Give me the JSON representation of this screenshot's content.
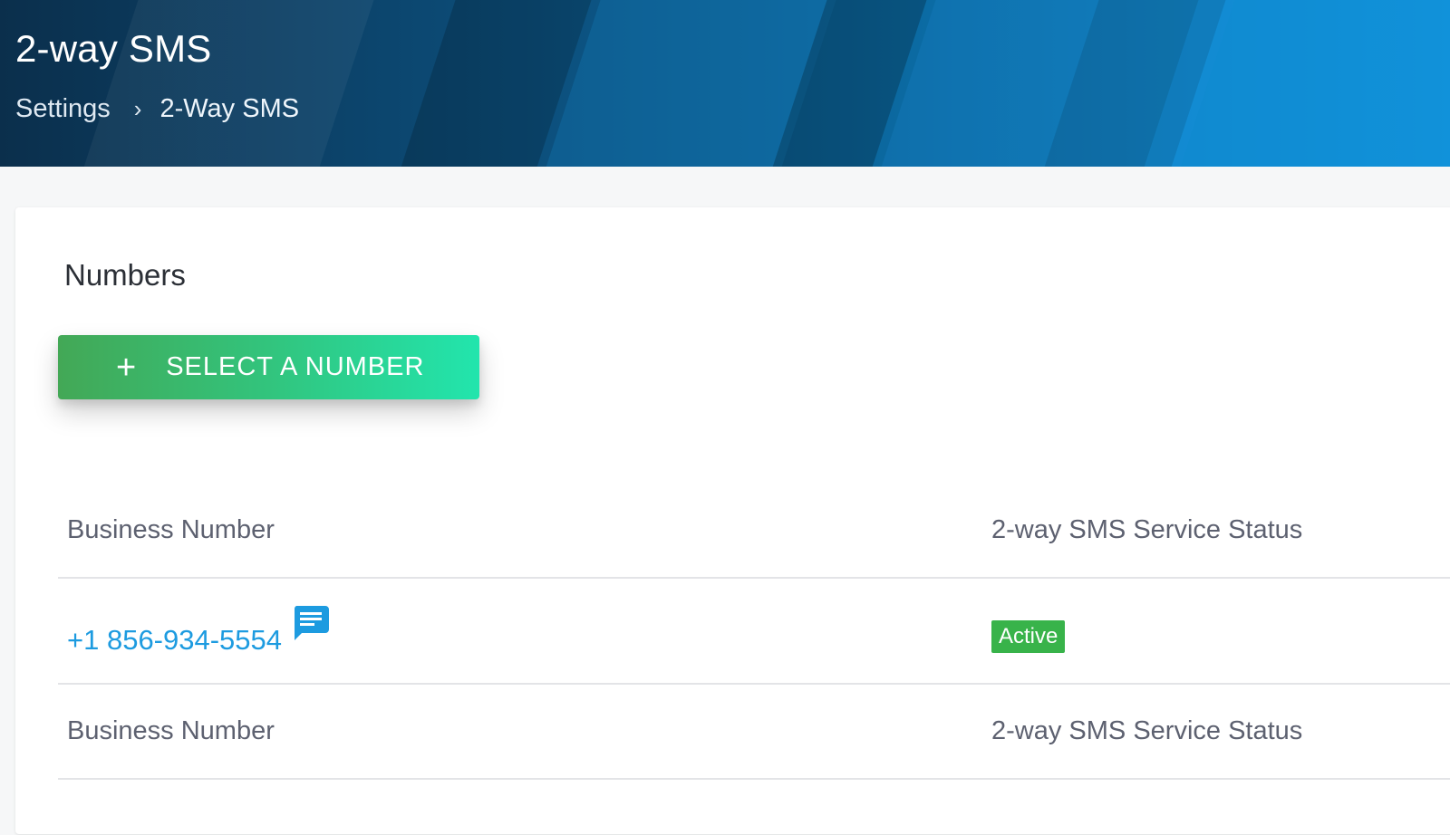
{
  "header": {
    "title": "2-way SMS",
    "breadcrumb": {
      "parent": "Settings",
      "separator": "›",
      "current": "2-Way SMS"
    }
  },
  "numbers_section": {
    "title": "Numbers",
    "select_button": {
      "icon": "plus-icon",
      "icon_glyph": "+",
      "label": "SELECT A NUMBER"
    },
    "table": {
      "columns": [
        "Business Number",
        "2-way SMS Service Status"
      ],
      "rows": [
        {
          "number": "+1 856-934-5554",
          "icon": "message-icon",
          "status": "Active"
        }
      ],
      "footer_columns": [
        "Business Number",
        "2-way SMS Service Status"
      ]
    }
  },
  "colors": {
    "link": "#1d9be0",
    "status_active": "#38b34a",
    "button_gradient_start": "#43a856",
    "button_gradient_end": "#22e5ad",
    "header_dark": "#0b2f4c",
    "header_light": "#0e8ed0"
  }
}
